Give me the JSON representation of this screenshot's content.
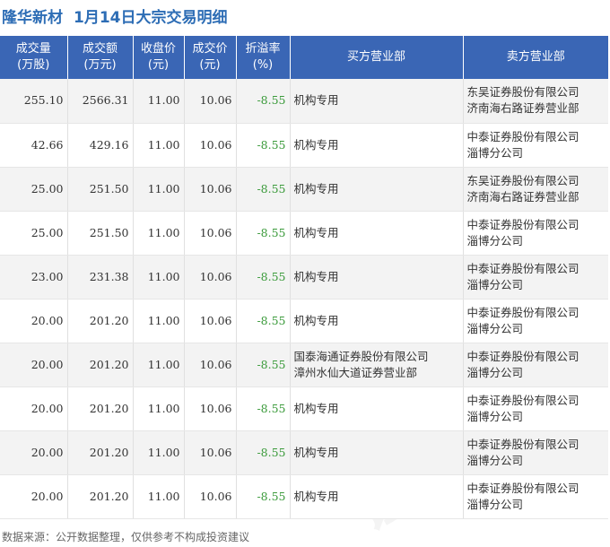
{
  "header": {
    "stock_name": "隆华新材",
    "title": "1月14日大宗交易明细"
  },
  "table": {
    "columns": [
      [
        "成交量",
        "(万股)"
      ],
      [
        "成交额",
        "(万元)"
      ],
      [
        "收盘价",
        "(元)"
      ],
      [
        "成交价",
        "(元)"
      ],
      [
        "折溢率",
        "(%)"
      ],
      [
        "买方营业部"
      ],
      [
        "卖方营业部"
      ]
    ],
    "rows": [
      {
        "volume": "255.10",
        "amount": "2566.31",
        "close": "11.00",
        "price": "10.06",
        "premium": "-8.55",
        "buyer": [
          "机构专用"
        ],
        "seller": [
          "东吴证券股份有限公司",
          "济南海右路证券营业部"
        ]
      },
      {
        "volume": "42.66",
        "amount": "429.16",
        "close": "11.00",
        "price": "10.06",
        "premium": "-8.55",
        "buyer": [
          "机构专用"
        ],
        "seller": [
          "中泰证券股份有限公司",
          "淄博分公司"
        ]
      },
      {
        "volume": "25.00",
        "amount": "251.50",
        "close": "11.00",
        "price": "10.06",
        "premium": "-8.55",
        "buyer": [
          "机构专用"
        ],
        "seller": [
          "东吴证券股份有限公司",
          "济南海右路证券营业部"
        ]
      },
      {
        "volume": "25.00",
        "amount": "251.50",
        "close": "11.00",
        "price": "10.06",
        "premium": "-8.55",
        "buyer": [
          "机构专用"
        ],
        "seller": [
          "中泰证券股份有限公司",
          "淄博分公司"
        ]
      },
      {
        "volume": "23.00",
        "amount": "231.38",
        "close": "11.00",
        "price": "10.06",
        "premium": "-8.55",
        "buyer": [
          "机构专用"
        ],
        "seller": [
          "中泰证券股份有限公司",
          "淄博分公司"
        ]
      },
      {
        "volume": "20.00",
        "amount": "201.20",
        "close": "11.00",
        "price": "10.06",
        "premium": "-8.55",
        "buyer": [
          "机构专用"
        ],
        "seller": [
          "中泰证券股份有限公司",
          "淄博分公司"
        ]
      },
      {
        "volume": "20.00",
        "amount": "201.20",
        "close": "11.00",
        "price": "10.06",
        "premium": "-8.55",
        "buyer": [
          "国泰海通证券股份有限公司",
          "漳州水仙大道证券营业部"
        ],
        "seller": [
          "中泰证券股份有限公司",
          "淄博分公司"
        ]
      },
      {
        "volume": "20.00",
        "amount": "201.20",
        "close": "11.00",
        "price": "10.06",
        "premium": "-8.55",
        "buyer": [
          "机构专用"
        ],
        "seller": [
          "中泰证券股份有限公司",
          "淄博分公司"
        ]
      },
      {
        "volume": "20.00",
        "amount": "201.20",
        "close": "11.00",
        "price": "10.06",
        "premium": "-8.55",
        "buyer": [
          "机构专用"
        ],
        "seller": [
          "中泰证券股份有限公司",
          "淄博分公司"
        ]
      },
      {
        "volume": "20.00",
        "amount": "201.20",
        "close": "11.00",
        "price": "10.06",
        "premium": "-8.55",
        "buyer": [
          "机构专用"
        ],
        "seller": [
          "中泰证券股份有限公司",
          "淄博分公司"
        ]
      }
    ]
  },
  "footer": {
    "source": "数据来源：公开数据整理，仅供参考不构成投资建议"
  },
  "watermark": {
    "text": "证券之星"
  },
  "colors": {
    "accent": "#3a66b5",
    "title": "#2d6db5",
    "negative": "#3a9a3a"
  }
}
